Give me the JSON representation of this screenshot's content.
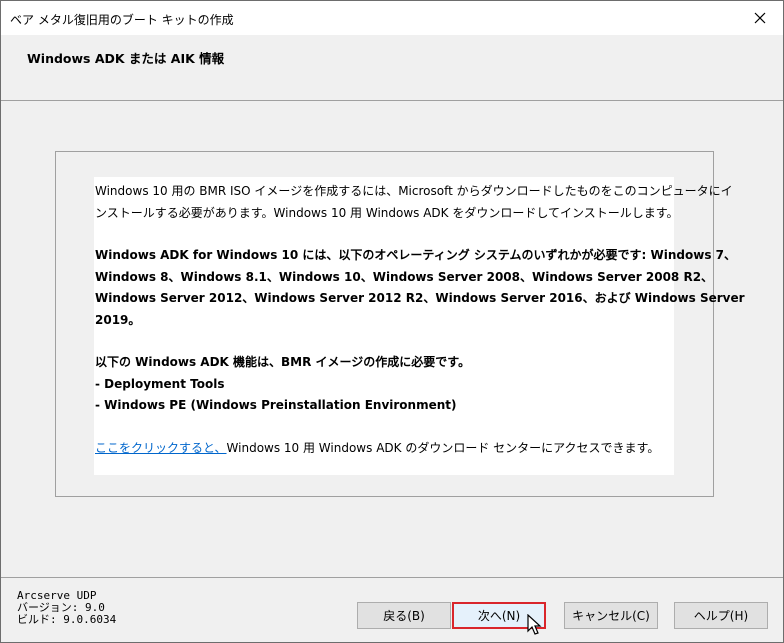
{
  "window": {
    "title": "ベア メタル復旧用のブート キットの作成",
    "close_glyph": "✕"
  },
  "header": {
    "title": "Windows ADK または AIK 情報"
  },
  "content": {
    "para1": [
      "Windows 10 用の BMR ISO イメージを作成するには、Microsoft からダウンロードしたものをこのコンピュータにイ",
      "ンストールする必要があります。Windows 10 用 Windows ADK をダウンロードしてインストールします。"
    ],
    "para2": [
      "Windows ADK for Windows 10 には、以下のオペレーティング システムのいずれかが必要です: Windows 7、",
      "Windows 8、Windows 8.1、Windows 10、Windows Server 2008、Windows Server 2008 R2、",
      "Windows Server 2012、Windows Server 2012 R2、Windows Server 2016、および Windows Server",
      "2019。"
    ],
    "para3": [
      "以下の Windows ADK 機能は、BMR イメージの作成に必要です。",
      "- Deployment Tools",
      "- Windows PE (Windows Preinstallation Environment)"
    ],
    "link_text": "ここをクリックすると、",
    "link_suffix": "Windows 10 用 Windows ADK のダウンロード センターにアクセスできます。"
  },
  "footer": {
    "product": "Arcserve UDP",
    "version": "バージョン: 9.0",
    "build": "ビルド: 9.0.6034"
  },
  "buttons": {
    "back": "戻る(B)",
    "next": "次へ(N)",
    "cancel": "キャンセル(C)",
    "help": "ヘルプ(H)"
  },
  "colors": {
    "link": "#0066cc",
    "focus_border": "#d9262c",
    "window_bg": "#f0f0f0"
  }
}
